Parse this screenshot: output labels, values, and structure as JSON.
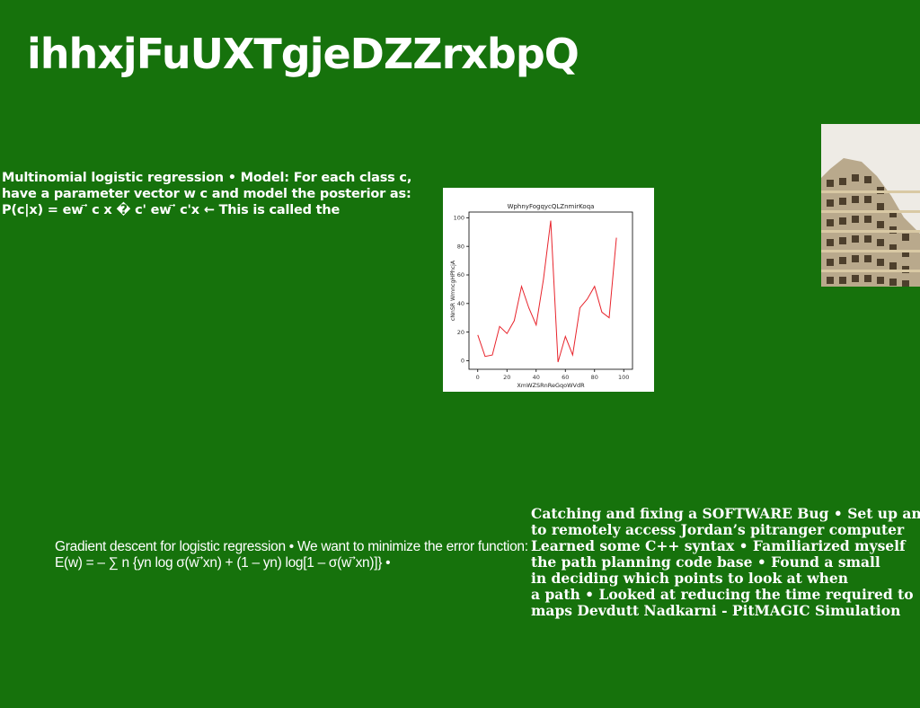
{
  "page": {
    "title": "ihhxjFuUXTgjeDZZrxbpQ",
    "background": "#16720c"
  },
  "block_logistic": {
    "text": "Multinomial logistic regression • Model: For each class c, have a parameter vector w c and model the posterior as: P(c|x) = ew ⃗ c x � c' ew ⃗ c'x ← This is called the"
  },
  "block_gradient": {
    "text": "Gradient descent for logistic regression • We want to minimize the error function: E(w) = – ∑ n {yn log σ(w ⃗xn) + (1 – yn) log[1 – σ(w ⃗xn)]} •"
  },
  "block_bug": {
    "lines": [
      "Catching and fixing a SOFTWARE Bug • Set up and",
      "to remotely access Jordan’s pitranger computer",
      "Learned some C++ syntax • Familiarized myself",
      "the path planning code base • Found a small",
      "in deciding which points to look at when",
      "a path • Looked at reducing the time required to",
      "maps Devdutt Nadkarni - PitMAGIC Simulation"
    ]
  },
  "photo": {
    "subject": "building-facade-photo"
  },
  "chart_data": {
    "type": "line",
    "title": "WphnyFogqycQLZnmirKoqa",
    "xlabel": "XmWZSRnReGqoWVdR",
    "ylabel": "cNnSR WmncgHPhcjA",
    "x": [
      0,
      5,
      10,
      15,
      20,
      25,
      30,
      35,
      40,
      45,
      50,
      55,
      60,
      65,
      70,
      75,
      80,
      85,
      90,
      95,
      100
    ],
    "series": [
      {
        "values": [
          18,
          3,
          4,
          24,
          19,
          28,
          52,
          37,
          25,
          57,
          98,
          -1,
          17,
          4,
          37,
          43,
          52,
          34,
          30,
          86,
          null
        ],
        "color": "#e8242c"
      }
    ],
    "xlim": [
      -6,
      106
    ],
    "ylim": [
      -6,
      104
    ],
    "xticks": [
      0,
      20,
      40,
      60,
      80,
      100
    ],
    "yticks": [
      0,
      20,
      40,
      60,
      80,
      100
    ],
    "grid": false
  }
}
